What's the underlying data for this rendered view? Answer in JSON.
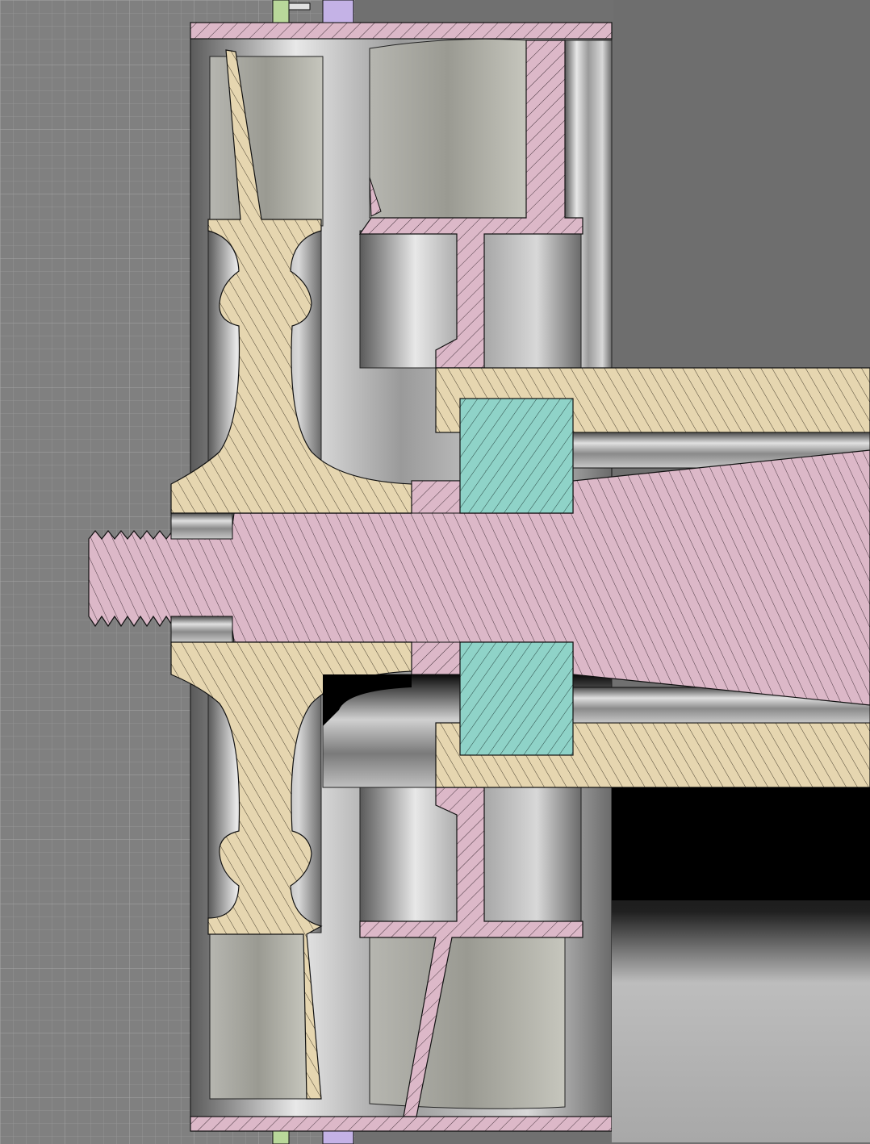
{
  "view": {
    "type": "cad-section-view",
    "background": "#808080",
    "grid_color": "#9a9a9a"
  },
  "materials": {
    "shaft": "#dcb8c8",
    "turbine_wheel": "#e6d6b0",
    "bearing": "#8fd3c8",
    "housing": "#dcb8c8",
    "hatch_line": "#2a2a2a",
    "outline": "#111111",
    "steel_light": "#e8e8e8",
    "steel_mid": "#a0a0a0",
    "steel_dark": "#3c3c3c"
  },
  "parts": [
    {
      "id": "threaded-shaft",
      "material": "shaft"
    },
    {
      "id": "turbine-wheel-upper",
      "material": "turbine_wheel"
    },
    {
      "id": "turbine-wheel-lower",
      "material": "turbine_wheel"
    },
    {
      "id": "nozzle-ring-upper",
      "material": "housing"
    },
    {
      "id": "nozzle-ring-lower",
      "material": "housing"
    },
    {
      "id": "bearing-upper",
      "material": "bearing"
    },
    {
      "id": "bearing-lower",
      "material": "bearing"
    },
    {
      "id": "bearing-sleeve-upper",
      "material": "turbine_wheel"
    },
    {
      "id": "bearing-sleeve-lower",
      "material": "turbine_wheel"
    },
    {
      "id": "outer-casing-top-flange",
      "material": "housing"
    },
    {
      "id": "outer-casing-bottom-flange",
      "material": "housing"
    }
  ]
}
